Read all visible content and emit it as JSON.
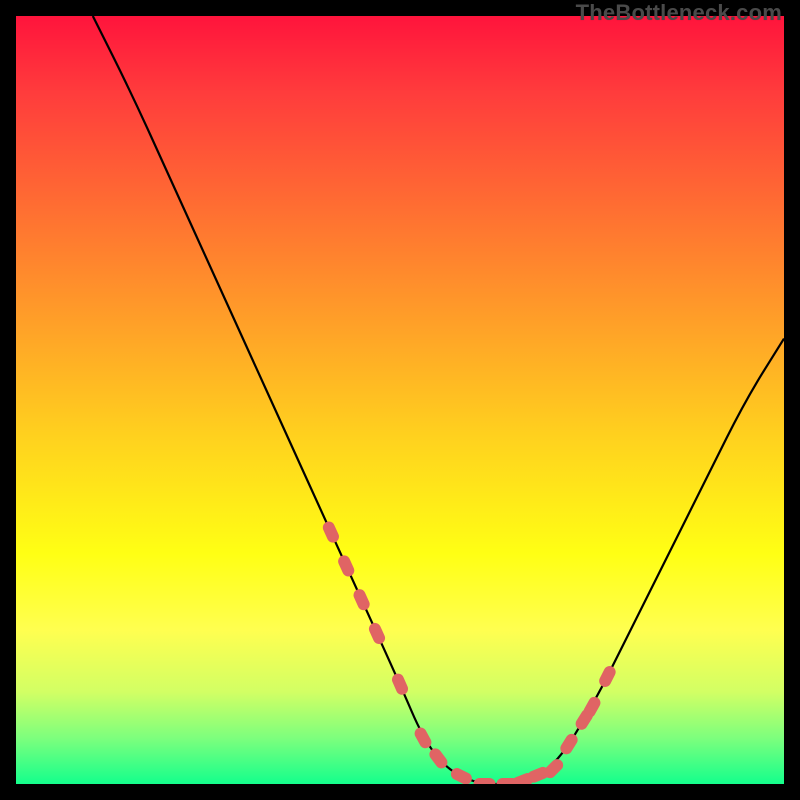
{
  "attribution": "TheBottleneck.com",
  "chart_data": {
    "type": "line",
    "title": "",
    "xlabel": "",
    "ylabel": "",
    "xlim": [
      0,
      100
    ],
    "ylim": [
      0,
      100
    ],
    "series": [
      {
        "name": "bottleneck-curve",
        "x": [
          10,
          15,
          20,
          25,
          30,
          35,
          40,
          45,
          50,
          53,
          56,
          60,
          65,
          70,
          75,
          80,
          85,
          90,
          95,
          100
        ],
        "y": [
          100,
          90,
          79,
          68,
          57,
          46,
          35,
          24,
          13,
          6,
          2,
          0,
          0,
          2,
          10,
          20,
          30,
          40,
          50,
          58
        ]
      }
    ],
    "markers": [
      {
        "series": "bottleneck-curve",
        "color": "#e06464",
        "points_x": [
          41,
          43,
          45,
          47,
          50,
          53,
          55,
          58,
          61,
          64,
          66,
          68,
          70,
          72,
          74,
          75,
          77
        ],
        "note": "highlighted segment pills near trough"
      }
    ]
  }
}
